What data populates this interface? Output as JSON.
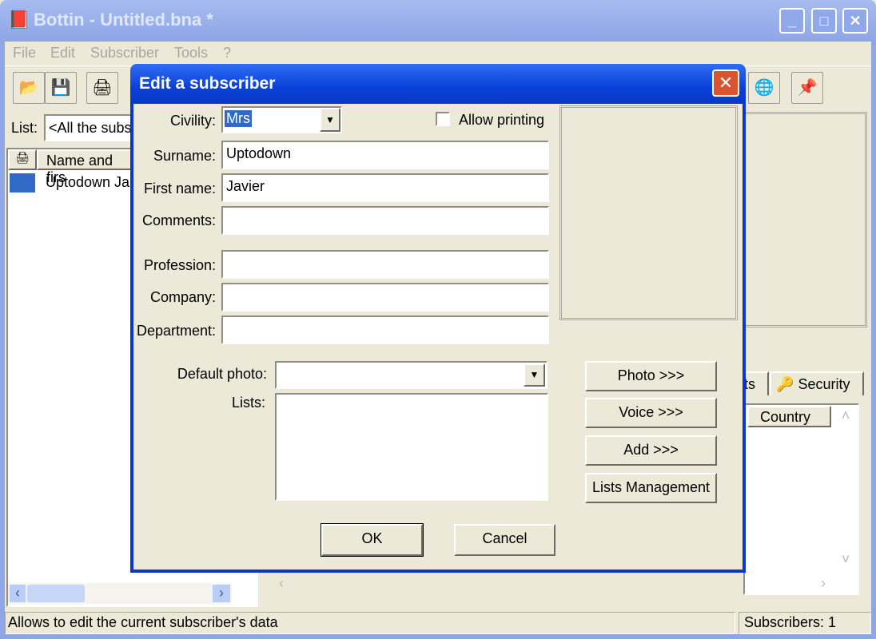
{
  "window": {
    "title": "Bottin - Untitled.bna *",
    "min": "_",
    "max": "□",
    "close": "✕"
  },
  "menu": [
    "File",
    "Edit",
    "Subscriber",
    "Tools",
    "?"
  ],
  "list": {
    "label": "List:",
    "value": "<All the subs"
  },
  "table": {
    "header": "Name and firs",
    "rows": [
      "Uptodown Ja"
    ]
  },
  "right_tabs": {
    "partial": "sts",
    "security": "Security"
  },
  "right_table": {
    "header": "Country"
  },
  "status": {
    "message": "Allows to edit the current subscriber's data",
    "count": "Subscribers: 1"
  },
  "dialog": {
    "title": "Edit a subscriber",
    "civility_label": "Civility:",
    "civility_value": "Mrs",
    "allow_printing": "Allow printing",
    "allow_printing_checked": false,
    "surname_label": "Surname:",
    "surname": "Uptodown",
    "firstname_label": "First name:",
    "firstname": "Javier",
    "comments_label": "Comments:",
    "comments": "",
    "profession_label": "Profession:",
    "profession": "",
    "company_label": "Company:",
    "company": "",
    "department_label": "Department:",
    "department": "",
    "default_photo_label": "Default photo:",
    "default_photo": "",
    "lists_label": "Lists:",
    "photo_btn": "Photo >>>",
    "voice_btn": "Voice >>>",
    "add_btn": "Add >>>",
    "lists_mgmt_btn": "Lists Management",
    "ok": "OK",
    "cancel": "Cancel"
  },
  "colors": {
    "dialog_title": "#0a40d8",
    "window_inactive": "#8ea6e6",
    "face": "#ece9d8",
    "selection": "#316ac5"
  }
}
